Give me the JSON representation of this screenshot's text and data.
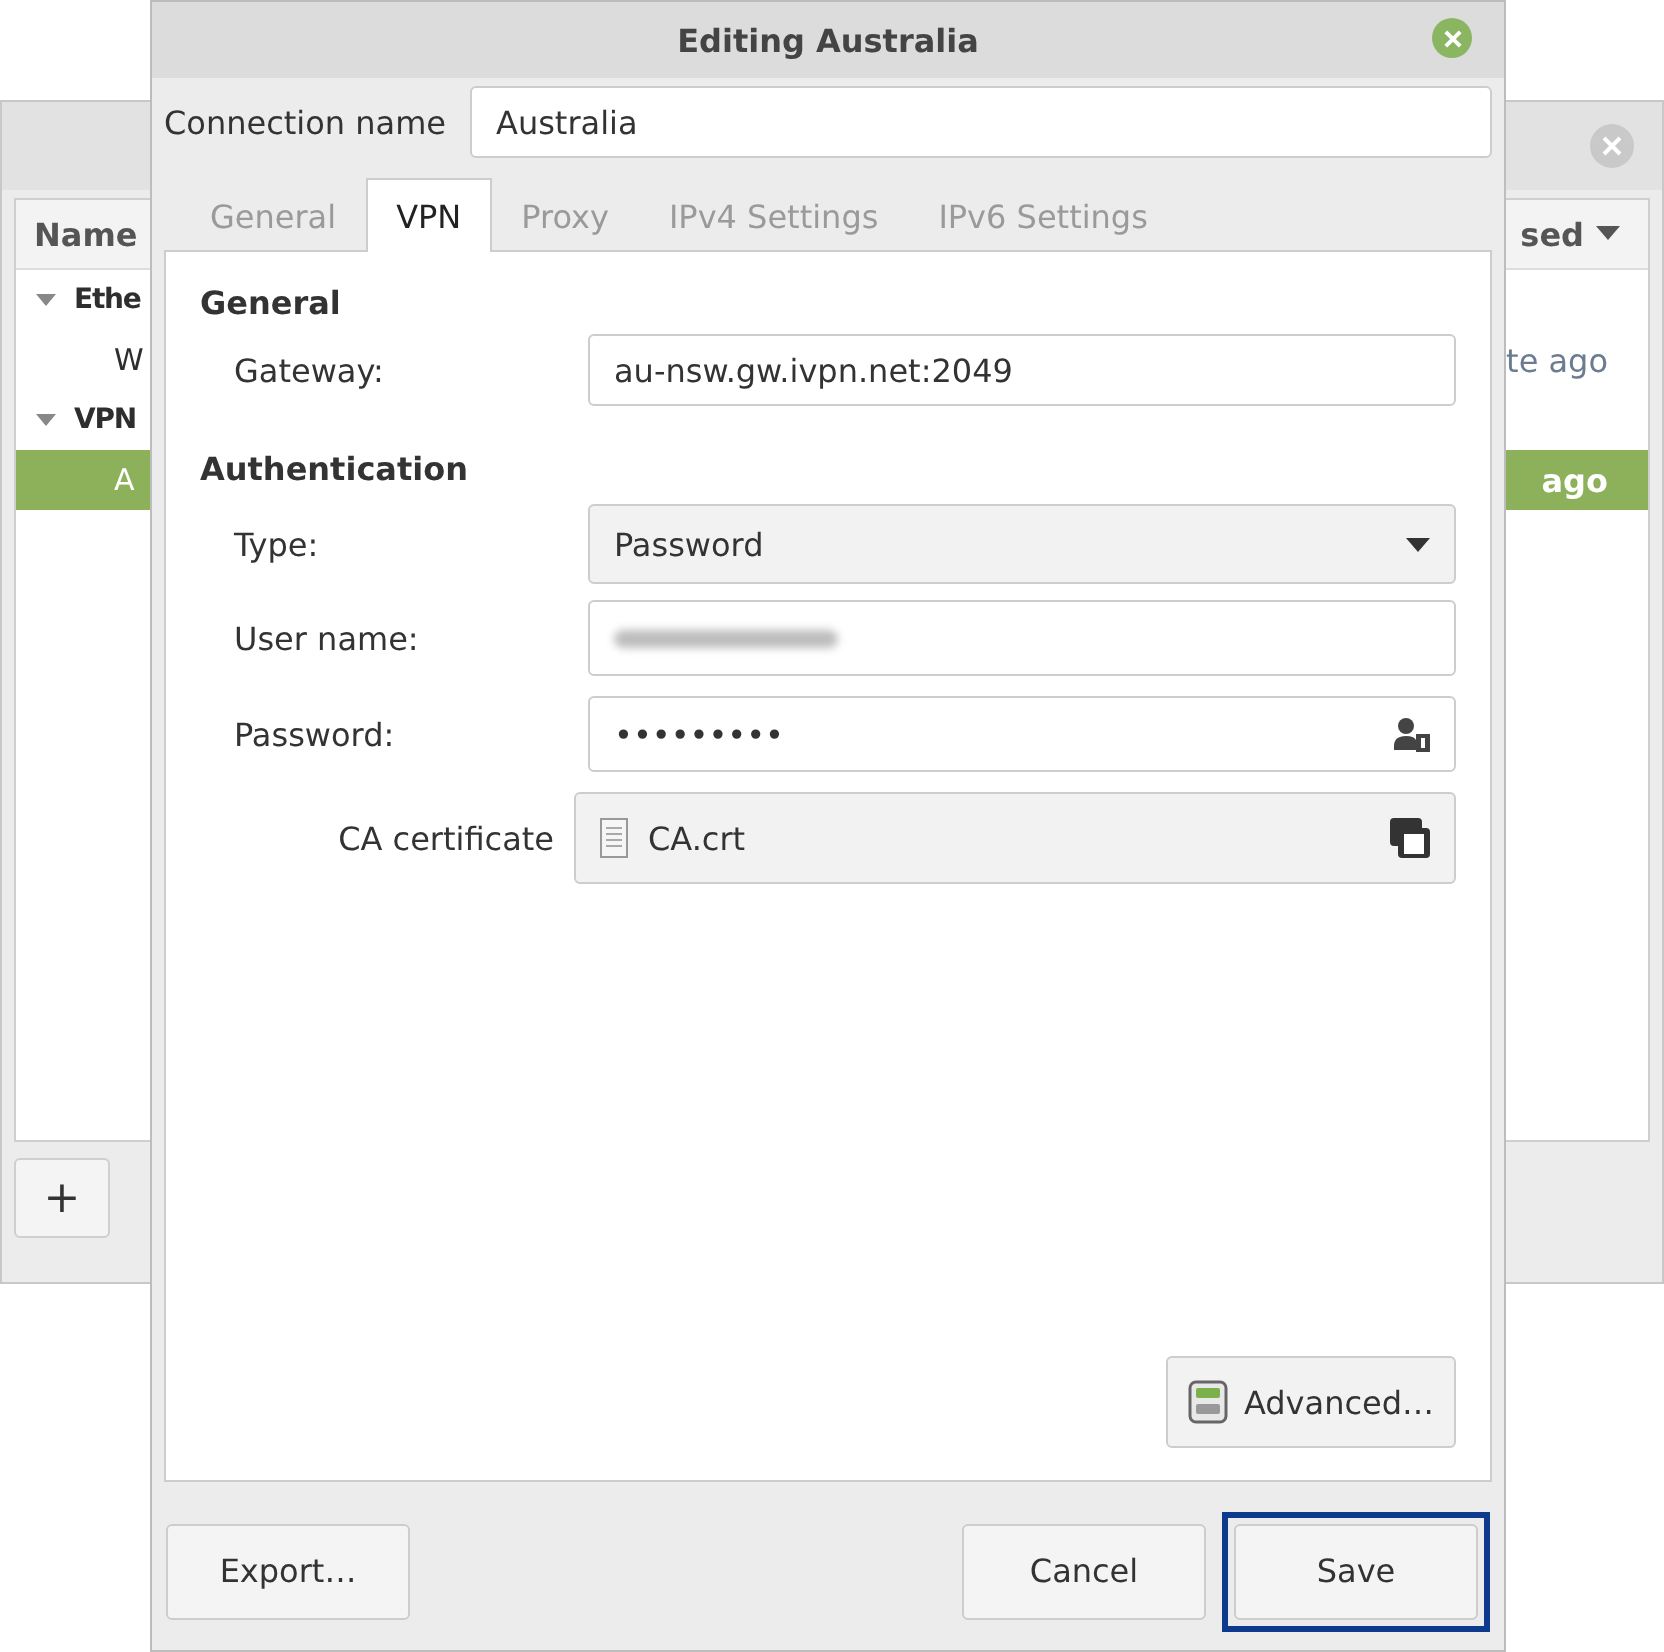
{
  "background_window": {
    "columns": {
      "column_1": "Name",
      "column_2": "sed"
    },
    "rows": [
      {
        "kind": "group",
        "name": "Ethe",
        "expanded": true
      },
      {
        "kind": "item",
        "name": "W",
        "time": "te ago",
        "selected": false
      },
      {
        "kind": "group",
        "name": "VPN",
        "expanded": true
      },
      {
        "kind": "item",
        "name": "A",
        "time": "ago",
        "selected": true
      }
    ],
    "add_button": "+"
  },
  "dialog": {
    "title": "Editing Australia",
    "connection_name": {
      "label": "Connection name",
      "value": "Australia"
    },
    "tabs": [
      {
        "label": "General",
        "selected": false
      },
      {
        "label": "VPN",
        "selected": true
      },
      {
        "label": "Proxy",
        "selected": false
      },
      {
        "label": "IPv4 Settings",
        "selected": false
      },
      {
        "label": "IPv6 Settings",
        "selected": false
      }
    ],
    "general": {
      "heading": "General",
      "gateway_label": "Gateway:",
      "gateway_value": "au-nsw.gw.ivpn.net:2049"
    },
    "authentication": {
      "heading": "Authentication",
      "type_label": "Type:",
      "type_value": "Password",
      "user_name_label": "User name:",
      "password_label": "Password:",
      "password_value": "•••••••••",
      "ca_label": "CA certificate",
      "ca_value": "CA.crt"
    },
    "advanced_button": "Advanced…",
    "buttons": [
      {
        "label": "Export…",
        "highlighted": false
      },
      {
        "label": "Cancel",
        "highlighted": false
      },
      {
        "label": "Save",
        "highlighted": true
      }
    ]
  }
}
